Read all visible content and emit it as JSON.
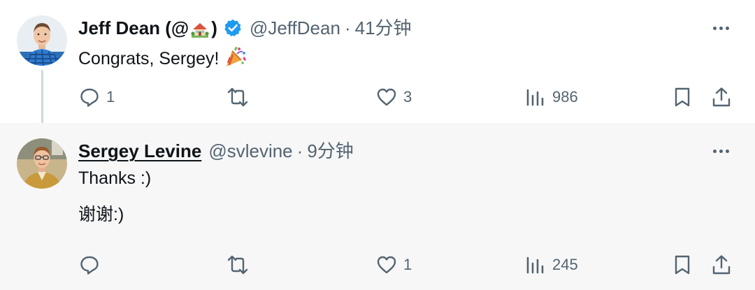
{
  "colors": {
    "verified": "#1d9bf0",
    "secondary_text": "#536471",
    "reply_background": "#f7f7f7",
    "thread_line": "#cfd9de"
  },
  "tweets": [
    {
      "name_prefix": "Jeff Dean (@",
      "name_emoji_icon": "house-with-garden-emoji",
      "name_suffix": ")",
      "verified": true,
      "handle": "@JeffDean",
      "separator": "·",
      "time": "41分钟",
      "text_lines": [
        "Congrats, Sergey!"
      ],
      "text_emoji_icon": "party-popper-emoji",
      "actions": {
        "replies": "1",
        "retweets": "",
        "likes": "3",
        "views": "986"
      }
    },
    {
      "name": "Sergey Levine",
      "verified": false,
      "handle": "@svlevine",
      "separator": "·",
      "time": "9分钟",
      "text_lines": [
        "Thanks :)",
        "谢谢:)"
      ],
      "actions": {
        "replies": "",
        "retweets": "",
        "likes": "1",
        "views": "245"
      }
    }
  ]
}
